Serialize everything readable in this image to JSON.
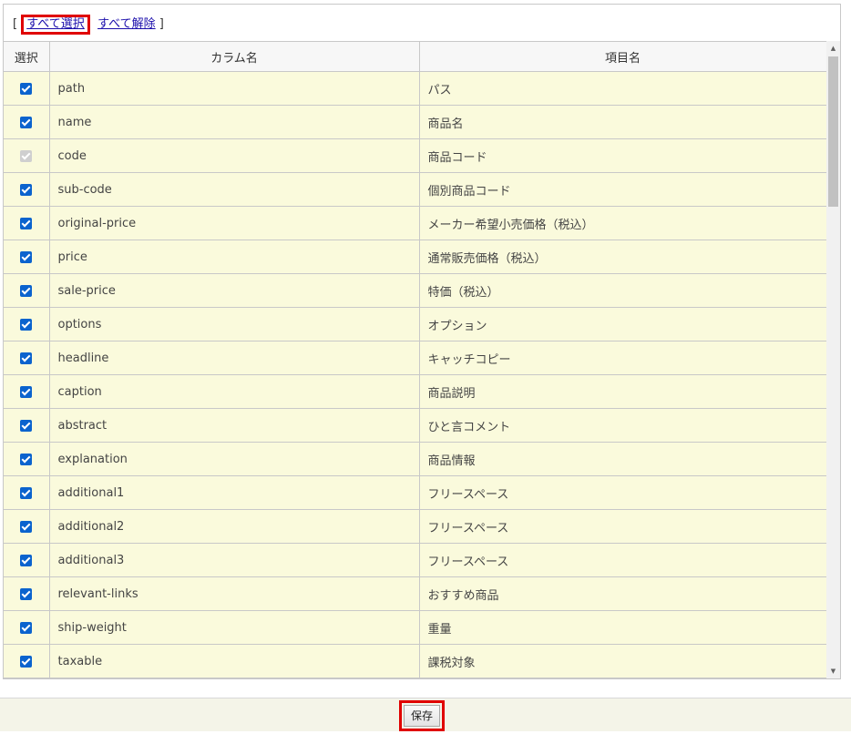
{
  "links": {
    "open_bracket": "[",
    "select_all": "すべて選択",
    "deselect_all": "すべて解除",
    "close_bracket": "]"
  },
  "table": {
    "headers": [
      "選択",
      "カラム名",
      "項目名"
    ],
    "rows": [
      {
        "checked": true,
        "disabled": false,
        "column": "path",
        "item": "パス"
      },
      {
        "checked": true,
        "disabled": false,
        "column": "name",
        "item": "商品名"
      },
      {
        "checked": true,
        "disabled": true,
        "column": "code",
        "item": "商品コード"
      },
      {
        "checked": true,
        "disabled": false,
        "column": "sub-code",
        "item": "個別商品コード"
      },
      {
        "checked": true,
        "disabled": false,
        "column": "original-price",
        "item": "メーカー希望小売価格（税込）"
      },
      {
        "checked": true,
        "disabled": false,
        "column": "price",
        "item": "通常販売価格（税込）"
      },
      {
        "checked": true,
        "disabled": false,
        "column": "sale-price",
        "item": "特価（税込）"
      },
      {
        "checked": true,
        "disabled": false,
        "column": "options",
        "item": "オプション"
      },
      {
        "checked": true,
        "disabled": false,
        "column": "headline",
        "item": "キャッチコピー"
      },
      {
        "checked": true,
        "disabled": false,
        "column": "caption",
        "item": "商品説明"
      },
      {
        "checked": true,
        "disabled": false,
        "column": "abstract",
        "item": "ひと言コメント"
      },
      {
        "checked": true,
        "disabled": false,
        "column": "explanation",
        "item": "商品情報"
      },
      {
        "checked": true,
        "disabled": false,
        "column": "additional1",
        "item": "フリースペース"
      },
      {
        "checked": true,
        "disabled": false,
        "column": "additional2",
        "item": "フリースペース"
      },
      {
        "checked": true,
        "disabled": false,
        "column": "additional3",
        "item": "フリースペース"
      },
      {
        "checked": true,
        "disabled": false,
        "column": "relevant-links",
        "item": "おすすめ商品"
      },
      {
        "checked": true,
        "disabled": false,
        "column": "ship-weight",
        "item": "重量"
      },
      {
        "checked": true,
        "disabled": false,
        "column": "taxable",
        "item": "課税対象"
      }
    ]
  },
  "footer": {
    "save_label": "保存"
  },
  "colors": {
    "highlight": "#e00000",
    "row_bg": "#fafadc",
    "checkbox": "#0b63ce"
  }
}
